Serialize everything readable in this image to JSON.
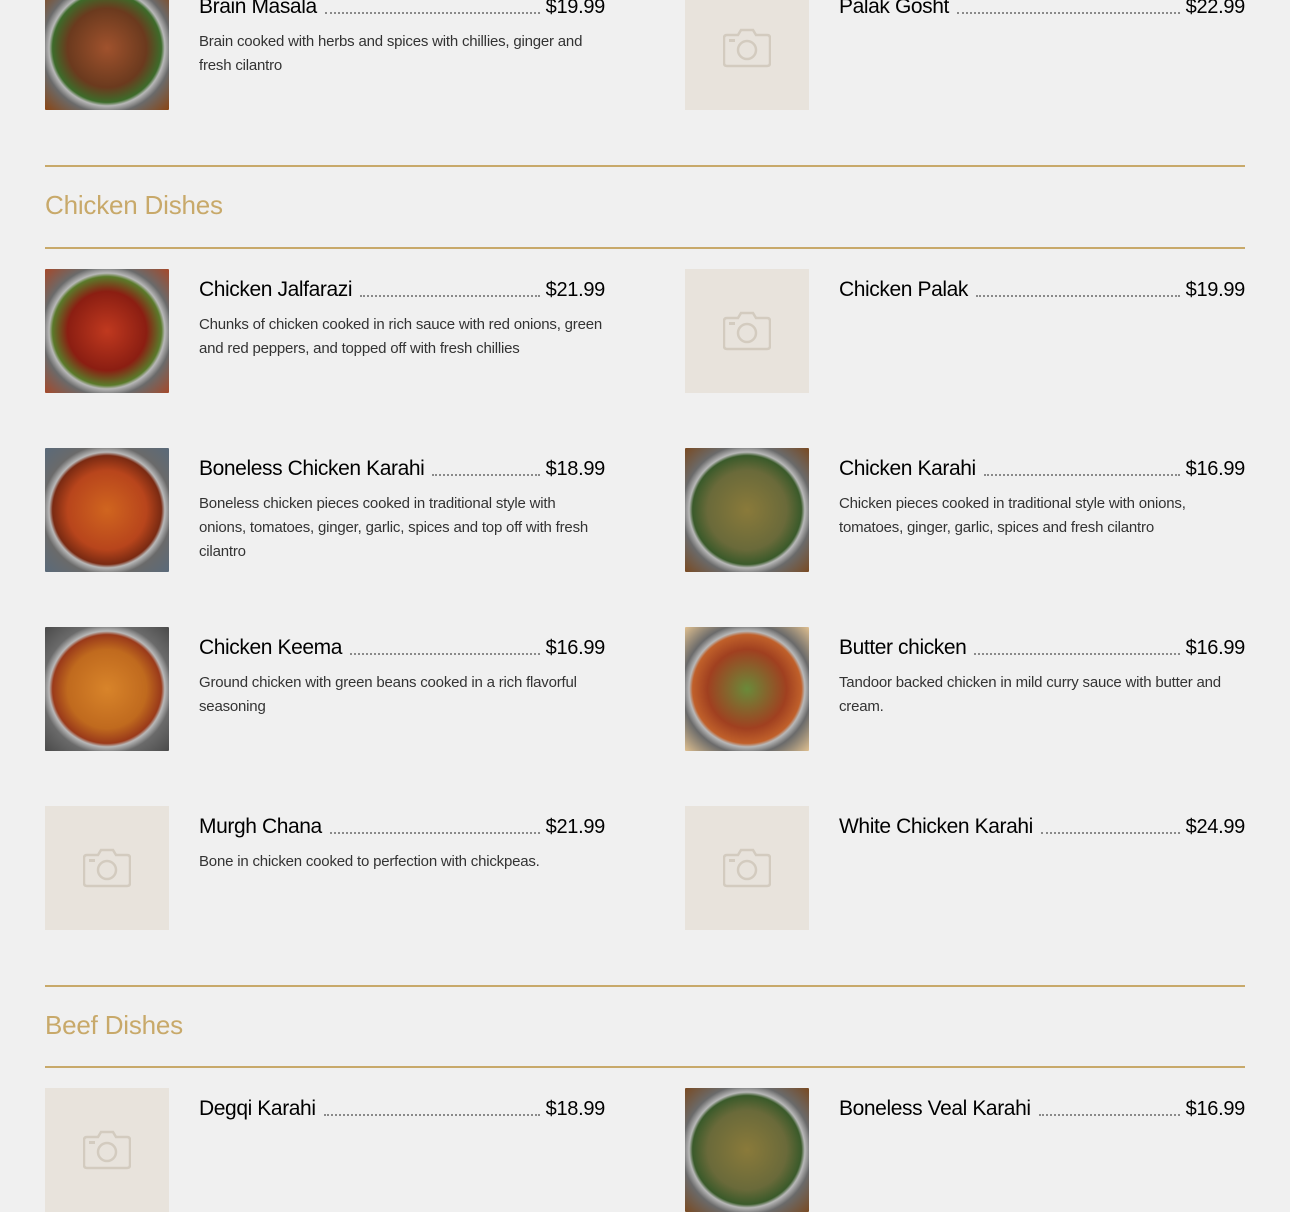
{
  "accent_color": "#c8a96a",
  "placeholder_icon": "camera-icon",
  "top_items": [
    {
      "name": "Brain Masala",
      "price": "$19.99",
      "description": "Brain cooked with herbs and spices with chillies, ginger and fresh cilantro",
      "image": "photo"
    },
    {
      "name": "Palak Gosht",
      "price": "$22.99",
      "description": "",
      "image": "placeholder"
    }
  ],
  "sections": [
    {
      "title": "Chicken Dishes",
      "items": [
        {
          "name": "Chicken Jalfarazi",
          "price": "$21.99",
          "description": "Chunks of chicken cooked in rich sauce with red onions, green and red peppers, and topped off with fresh chillies",
          "image": "photo"
        },
        {
          "name": "Chicken Palak",
          "price": "$19.99",
          "description": "",
          "image": "placeholder"
        },
        {
          "name": "Boneless Chicken Karahi",
          "price": "$18.99",
          "description": "Boneless chicken pieces cooked in traditional style with onions, tomatoes, ginger, garlic, spices and top off with fresh cilantro",
          "image": "photo"
        },
        {
          "name": "Chicken Karahi",
          "price": "$16.99",
          "description": "Chicken pieces cooked in traditional style with onions, tomatoes, ginger, garlic, spices and fresh cilantro",
          "image": "photo"
        },
        {
          "name": "Chicken Keema",
          "price": "$16.99",
          "description": "Ground chicken with green beans cooked in a rich flavorful seasoning",
          "image": "photo"
        },
        {
          "name": "Butter chicken",
          "price": "$16.99",
          "description": "Tandoor backed chicken in mild curry sauce with butter and cream.",
          "image": "photo"
        },
        {
          "name": "Murgh Chana",
          "price": "$21.99",
          "description": "Bone in chicken cooked to perfection with chickpeas.",
          "image": "placeholder"
        },
        {
          "name": "White Chicken Karahi",
          "price": "$24.99",
          "description": "",
          "image": "placeholder"
        }
      ]
    },
    {
      "title": "Beef Dishes",
      "items": [
        {
          "name": "Degqi Karahi",
          "price": "$18.99",
          "description": "",
          "image": "placeholder"
        },
        {
          "name": "Boneless Veal Karahi",
          "price": "$16.99",
          "description": "",
          "image": "photo"
        }
      ]
    }
  ]
}
